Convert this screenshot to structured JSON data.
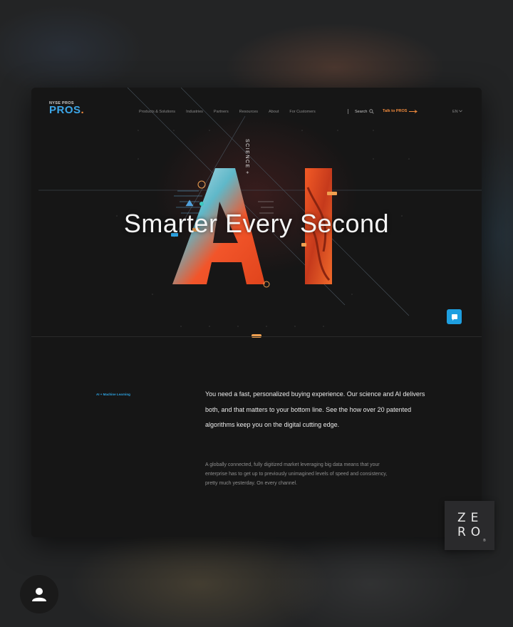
{
  "logo": {
    "exchange": "NYSE PROS",
    "brand": "PROS",
    "brand_dot": "."
  },
  "nav": {
    "items": [
      "Products & Solutions",
      "Industries",
      "Partners",
      "Resources",
      "About",
      "For Customers"
    ],
    "search_label": "Search",
    "cta_label": "Talk to PROS",
    "language": "EN"
  },
  "hero": {
    "vertical_text": "SCIENCE +",
    "ai_letters": "AI",
    "headline": "Smarter Every Second"
  },
  "section": {
    "label": "AI + Machine Learning",
    "lead": "You need a fast, personalized buying experience. Our science and AI delivers both, and that matters to your bottom line. See the how over 20 patented algorithms keep you on the digital cutting edge.",
    "body": "A globally connected, fully digitized market leveraging big data means that your enterprise has to get up to previously unimagined levels of speed and consistency, pretty much yesterday. On every channel."
  },
  "watermark": {
    "line1": "ZE",
    "line2": "RO",
    "mark": "®"
  },
  "icons": {
    "search": "search-icon",
    "arrow": "arrow-right-icon",
    "chevron": "chevron-down-icon",
    "chat": "chat-icon",
    "avatar": "user-avatar-icon"
  },
  "colors": {
    "accent_blue": "#1e9fe0",
    "accent_orange": "#f08a3c",
    "card_bg": "#161616",
    "page_bg": "#232425"
  }
}
